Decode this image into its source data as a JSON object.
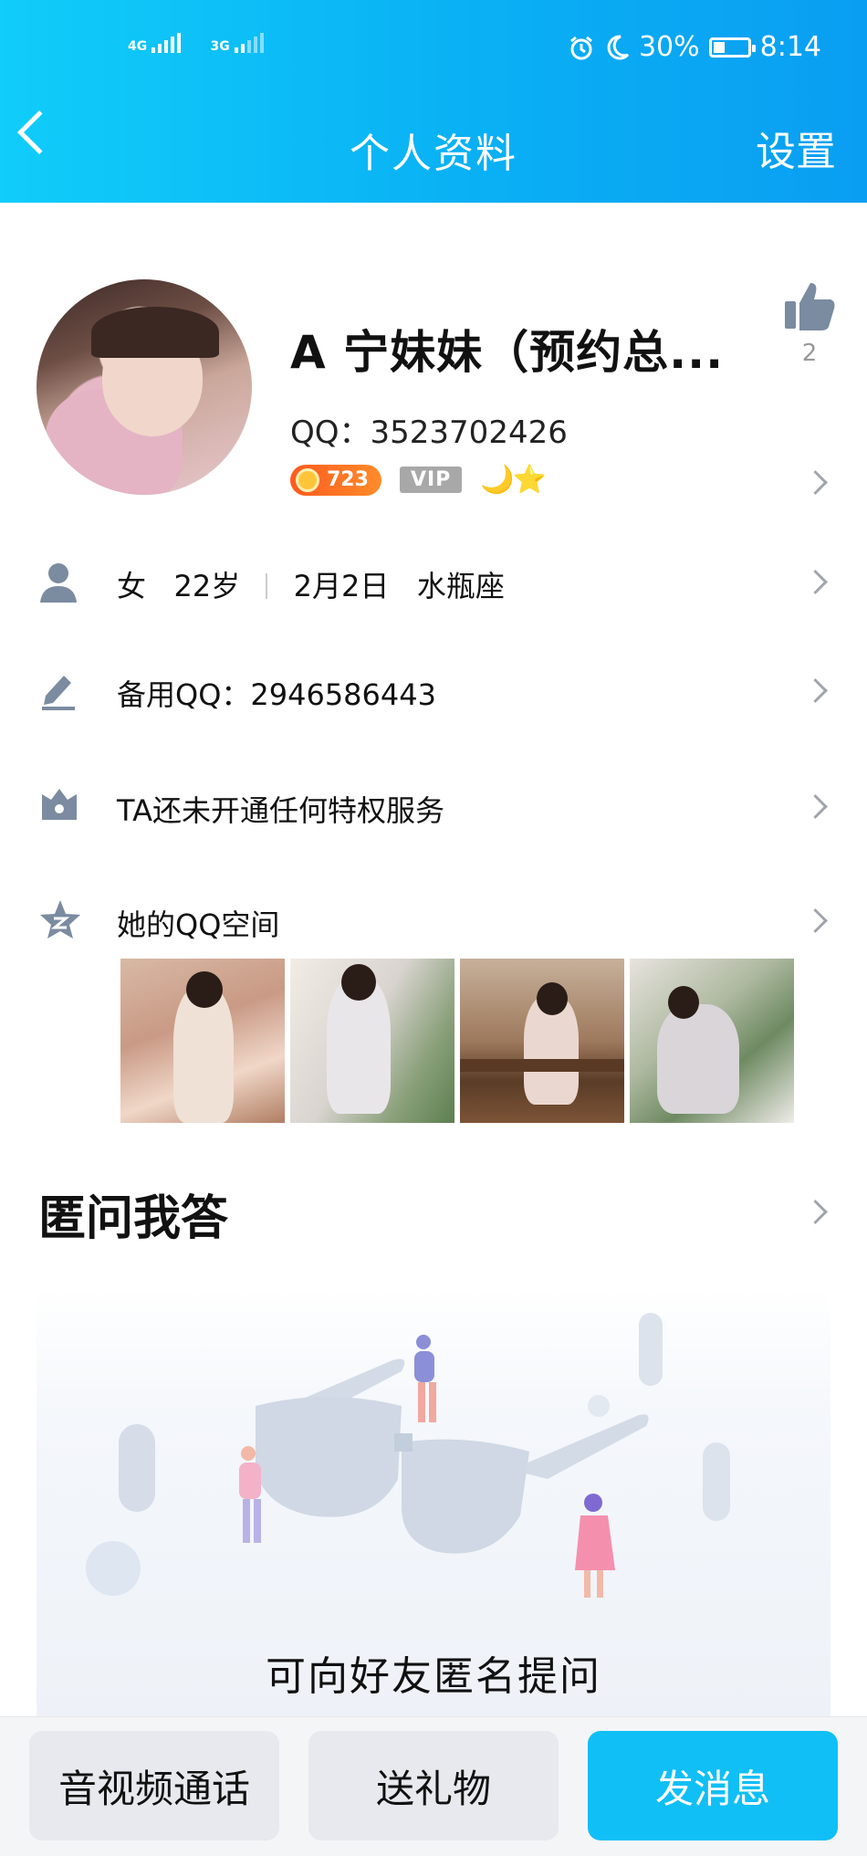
{
  "status_bar": {
    "network_1": "4G",
    "network_2": "3G",
    "battery": "30%",
    "time": "8:14"
  },
  "header": {
    "title": "个人资料",
    "settings": "设置"
  },
  "profile": {
    "nickname": "A  宁妹妹（预约总...",
    "qq": "QQ：3523702426",
    "level": "723",
    "vip": "VIP",
    "moon_star": "🌙⭐",
    "likes": "2"
  },
  "rows": {
    "gender": "女",
    "age": "22岁",
    "birthday": "2月2日",
    "zodiac": "水瓶座",
    "backup_qq": "备用QQ：2946586443",
    "privilege": "TA还未开通任何特权服务",
    "qzone": "她的QQ空间"
  },
  "qa": {
    "title": "匿问我答",
    "caption": "可向好友匿名提问"
  },
  "actions": {
    "call": "音视频通话",
    "gift": "送礼物",
    "message": "发消息"
  },
  "colors": {
    "header_start": "#10cdfa",
    "header_end": "#0a9ef2",
    "primary_button": "#10bff5"
  }
}
